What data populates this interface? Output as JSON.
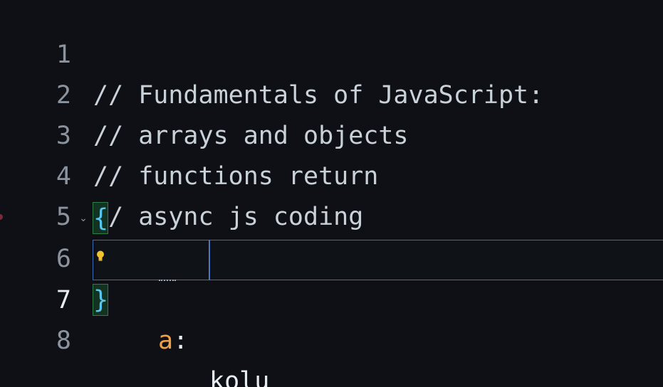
{
  "editor": {
    "lines": [
      {
        "number": "1",
        "text": "// Fundamentals of JavaScript:"
      },
      {
        "number": "2",
        "text": "// arrays and objects"
      },
      {
        "number": "3",
        "text": "// functions return"
      },
      {
        "number": "4",
        "text": "// async js coding"
      },
      {
        "number": "5",
        "text": ""
      },
      {
        "number": "6",
        "open_brace": "{"
      },
      {
        "number": "7",
        "key": "a",
        "colon": ":",
        "value": "kolu"
      },
      {
        "number": "8",
        "close_brace": "}"
      }
    ],
    "active_line": "7",
    "icons": {
      "fold": "chevron-down-icon",
      "lightbulb": "lightbulb-icon",
      "breakpoint": "breakpoint-dot-icon"
    },
    "colors": {
      "background": "#0e1015",
      "comment": "#c9d1d9",
      "key": "#f0a04b",
      "brace": "#57c7f0",
      "current_line_border": "#3b6cb0",
      "bracket_match_bg": "#123321"
    }
  }
}
